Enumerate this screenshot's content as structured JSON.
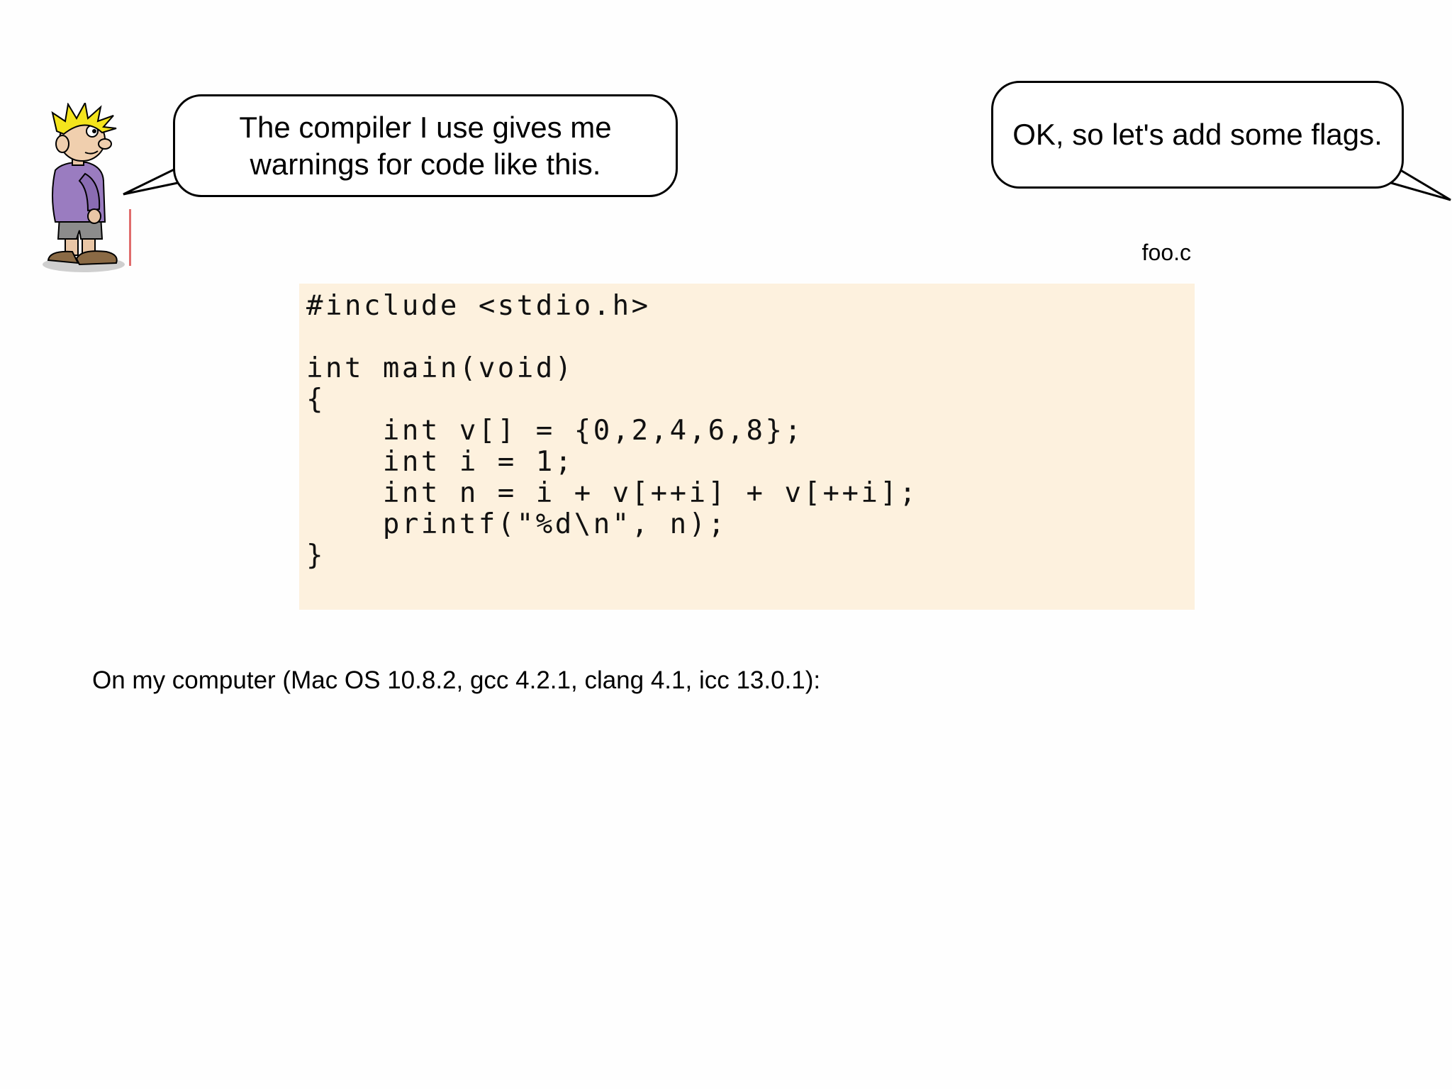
{
  "speech": {
    "left_line1": "The compiler I use gives me",
    "left_line2": "warnings for code like this.",
    "right": "OK, so let's add some flags."
  },
  "file_label": "foo.c",
  "code": {
    "lines": [
      "#include <stdio.h>",
      "",
      "int main(void)",
      "{",
      "    int v[] = {0,2,4,6,8};",
      "    int i = 1;",
      "    int n = i + v[++i] + v[++i];",
      "    printf(\"%d\\n\", n);",
      "}"
    ]
  },
  "caption": "On my computer (Mac OS 10.8.2, gcc 4.2.1, clang 4.1, icc 13.0.1):",
  "colors": {
    "code_background": "#fdf1de",
    "hair": "#f4e41c",
    "sweater": "#9a7cc0"
  }
}
